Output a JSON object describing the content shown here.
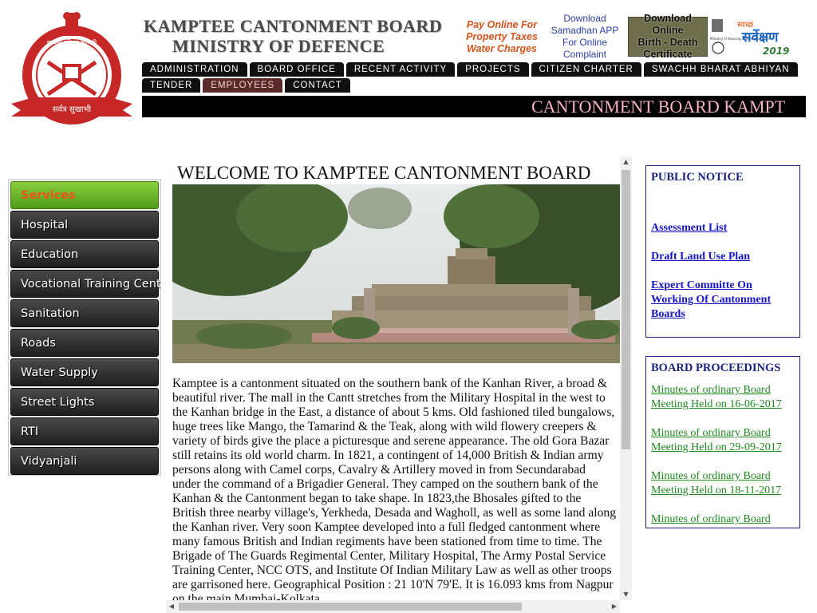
{
  "header": {
    "title_line1": "KAMPTEE CANTONMENT BOARD",
    "title_line2": "MINISTRY OF DEFENCE",
    "emblem_text_top": "छावनी परिषद कामठी",
    "emblem_text_bottom": "सर्वत्र सुखाभी",
    "banners": {
      "pay_line1": "Pay Online For",
      "pay_line2": "Property Taxes",
      "pay_line3": "Water Charges",
      "app_line1": "Download",
      "app_line2": "Samadhan APP",
      "app_line3": "For Online Complaint",
      "cert_line1": "Download Online",
      "cert_line2": "Birth - Death",
      "cert_line3": "Certificate",
      "swachh_hindi": "स्वच्छ",
      "swachh_main": "सर्वेक्षण",
      "swachh_year": "2019",
      "swachh_ministry": "Ministry of Housing and Urban Affairs"
    }
  },
  "nav": {
    "row1": [
      "ADMINISTRATION",
      "BOARD OFFICE",
      "RECENT ACTIVITY",
      "PROJECTS",
      "CITIZEN CHARTER",
      "SWACHH BHARAT ABHIYAN"
    ],
    "row2": [
      "TENDER",
      "EMPLOYEES",
      "CONTACT"
    ],
    "active": "EMPLOYEES"
  },
  "marquee": {
    "text": "CANTONMENT BOARD KAMPT"
  },
  "sidebar": {
    "items": [
      "Services",
      "Hospital",
      "Education",
      "Vocational Training Cent",
      "Sanitation",
      "Roads",
      "Water Supply",
      "Street Lights",
      "RTI",
      "Vidyanjali"
    ]
  },
  "main": {
    "welcome": "WELCOME TO KAMPTEE CANTONMENT BOARD",
    "body": "Kamptee is a cantonment situated on the southern bank of the Kanhan River, a broad & beautiful river. The mall in the Cantt stretches from the Military Hospital in the west to the Kanhan bridge in the East, a distance of about 5 kms. Old fashioned tiled bungalows, huge trees like Mango, the Tamarind & the Teak, along with wild flowery creepers & variety of birds give the place a picturesque and serene appearance. The old Gora Bazar still retains its old world charm. In 1821, a contingent of 14,000 British & Indian army persons along with Camel corps, Cavalry & Artillery moved in from Secundarabad under the command of a Brigadier General. They camped on the southern bank of the Kanhan & the Cantonment began to take shape. In 1823,the Bhosales gifted to the British three nearby village's, Yerkheda, Desada and Wagholl, as well as some land along the Kanhan river. Very soon Kamptee developed into a full fledged cantonment where many famous British and Indian regiments have been stationed from time to time. The Brigade of The Guards Regimental Center, Military Hospital, The Army Postal Service Training Center, NCC OTS, and Institute Of Indian Military Law as well as other troops are garrisoned here. Geographical Position : 21 10'N 79'E. It is 16.093 kms from Nagpur on the main Mumbai-Kolkata"
  },
  "public_notice": {
    "heading": "PUBLIC NOTICE",
    "links": [
      "Assessment List",
      "Draft Land Use Plan",
      "Expert Committe On Working Of Cantonment Boards"
    ]
  },
  "board_proceedings": {
    "heading": "BOARD PROCEEDINGS",
    "links": [
      "Minutes of ordinary Board Meeting Held on 16-06-2017 ",
      "Minutes of ordinary Board Meeting Held on 29-09-2017 ",
      "Minutes of ordinary Board Meeting Held on 18-11-2017 ",
      "Minutes of ordinary Board"
    ]
  },
  "scrollbars": {
    "up_arrow": "▲",
    "down_arrow": "▼",
    "left_arrow": "◀",
    "right_arrow": "▶"
  },
  "colors": {
    "nav_bg": "#101010",
    "active_nav": "#5a2a2a",
    "sidebar_active": "#6fbf2a",
    "panel_border": "#1a237e",
    "notice_link": "#1515c8",
    "proceedings_link": "#1e8a1e",
    "marquee_text": "#f5b3c3"
  }
}
